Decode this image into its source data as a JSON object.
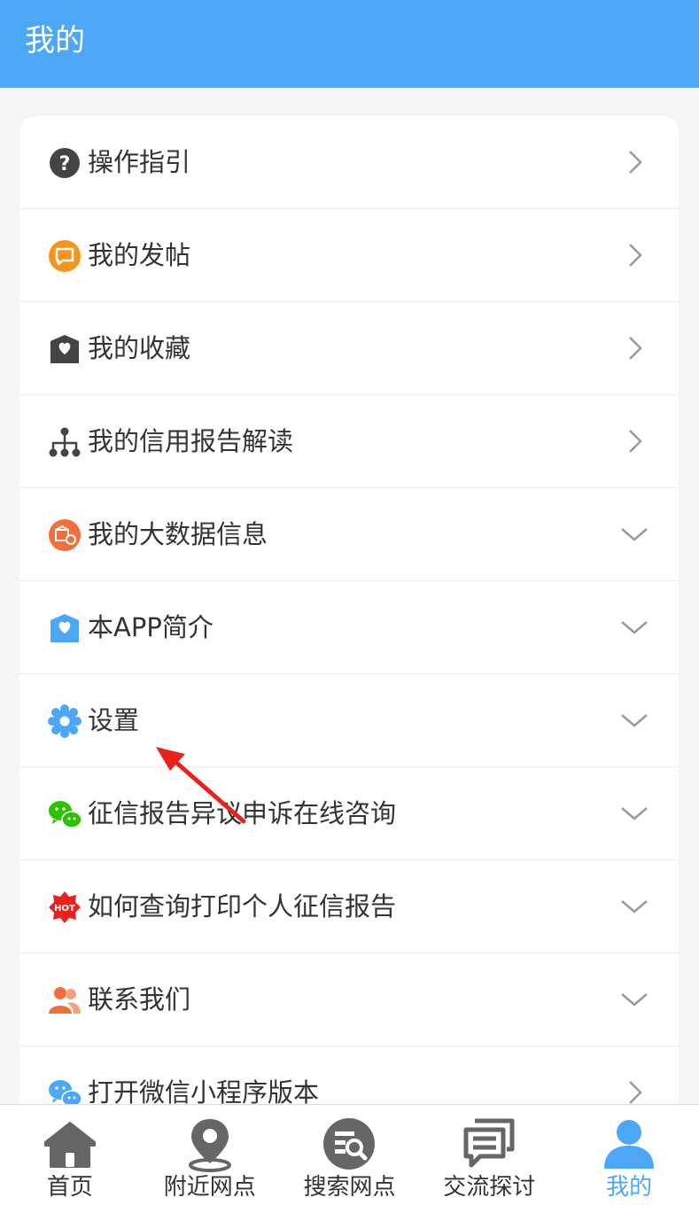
{
  "header": {
    "title": "我的"
  },
  "menu": [
    {
      "label": "操作指引",
      "icon": "question-circle-icon",
      "arrow": "chevron-right"
    },
    {
      "label": "我的发帖",
      "icon": "post-message-icon",
      "arrow": "chevron-right"
    },
    {
      "label": "我的收藏",
      "icon": "favorites-heart-icon",
      "arrow": "chevron-right"
    },
    {
      "label": "我的信用报告解读",
      "icon": "hierarchy-icon",
      "arrow": "chevron-right"
    },
    {
      "label": "我的大数据信息",
      "icon": "bank-data-icon",
      "arrow": "chevron-down"
    },
    {
      "label": "本APP简介",
      "icon": "app-intro-heart-icon",
      "arrow": "chevron-down"
    },
    {
      "label": "设置",
      "icon": "gear-icon",
      "arrow": "chevron-down"
    },
    {
      "label": "征信报告异议申诉在线咨询",
      "icon": "wechat-icon",
      "arrow": "chevron-down"
    },
    {
      "label": "如何查询打印个人征信报告",
      "icon": "hot-badge-icon",
      "arrow": "chevron-down"
    },
    {
      "label": "联系我们",
      "icon": "contacts-icon",
      "arrow": "chevron-down"
    },
    {
      "label": "打开微信小程序版本",
      "icon": "wechat-mini-program-icon",
      "arrow": "chevron-right"
    }
  ],
  "hot_badge_text": "HOT",
  "tabs": [
    {
      "label": "首页",
      "icon": "home-icon",
      "active": false
    },
    {
      "label": "附近网点",
      "icon": "location-pin-icon",
      "active": false
    },
    {
      "label": "搜索网点",
      "icon": "search-doc-icon",
      "active": false
    },
    {
      "label": "交流探讨",
      "icon": "chat-bubbles-icon",
      "active": false
    },
    {
      "label": "我的",
      "icon": "user-profile-icon",
      "active": true
    }
  ],
  "colors": {
    "header_bg": "#4ca8f7",
    "active_tab": "#4ca8f7",
    "annotation_arrow": "#e8231e"
  }
}
